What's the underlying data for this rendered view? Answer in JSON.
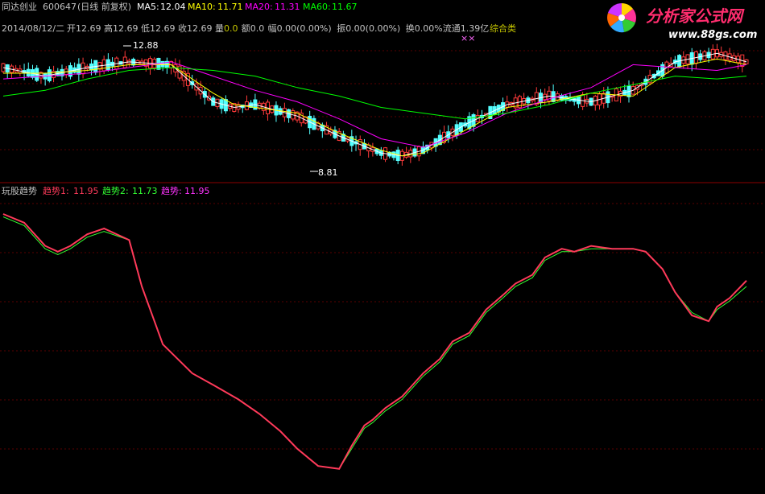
{
  "header": {
    "stock_name": "同达创业",
    "stock_code": "600647",
    "period_note": "(日线 前复权)",
    "ma_readouts": [
      {
        "label": "MA5:",
        "value": "12.04",
        "color": "#ffffff"
      },
      {
        "label": "MA10:",
        "value": "11.71",
        "color": "#ffff00"
      },
      {
        "label": "MA20:",
        "value": "11.31",
        "color": "#ff00ff"
      },
      {
        "label": "MA60:",
        "value": "11.67",
        "color": "#00ff00"
      }
    ]
  },
  "quote_line": {
    "date": "2014/08/12/二",
    "fields": [
      {
        "label": "开",
        "value": "12.69"
      },
      {
        "label": "高",
        "value": "12.69"
      },
      {
        "label": "低",
        "value": "12.69"
      },
      {
        "label": "收",
        "value": "12.69"
      },
      {
        "label": "量",
        "value": "0.0"
      },
      {
        "label": "额",
        "value": "0.0"
      },
      {
        "label": "幅",
        "value": "0.00(0.00%)"
      },
      {
        "label": "振",
        "value": "0.00(0.00%)"
      },
      {
        "label": "换",
        "value": "0.00%"
      },
      {
        "label": "流通",
        "value": "1.39亿"
      }
    ],
    "category": "综合类"
  },
  "watermark": {
    "text": "分析家公式网",
    "url": "www.88gs.com"
  },
  "indicator_header": {
    "name": "玩股趋势",
    "lines": [
      {
        "label": "趋势1:",
        "value": "11.95",
        "color": "#ff3a5a"
      },
      {
        "label": "趋势2:",
        "value": "11.73",
        "color": "#33ff33"
      },
      {
        "label": "趋势:",
        "value": "11.95",
        "color": "#ff33ff"
      }
    ]
  },
  "chart_data": [
    {
      "type": "candlestick",
      "annotations": [
        {
          "text": "12.88",
          "kind": "high"
        },
        {
          "text": "8.81",
          "kind": "low"
        },
        {
          "text": "××",
          "kind": "markers"
        }
      ],
      "ylim": [
        8.5,
        13.3
      ],
      "colors": {
        "up": "#ff3a3a",
        "down": "#54ffff",
        "ma5": "#ffffff",
        "ma10": "#ffff00",
        "ma20": "#ff00ff",
        "ma60": "#00ff00"
      },
      "series": [
        {
          "name": "MA5",
          "x": [
            0,
            10,
            20,
            30,
            40,
            50,
            55,
            60,
            70,
            80,
            90,
            95,
            100,
            110,
            120,
            130,
            140,
            150,
            160,
            170,
            177
          ],
          "values": [
            12.2,
            11.9,
            12.2,
            12.4,
            12.3,
            11.0,
            10.8,
            10.9,
            10.5,
            9.8,
            9.2,
            9.1,
            9.3,
            10.2,
            10.9,
            11.2,
            11.0,
            11.4,
            12.4,
            12.7,
            12.4
          ]
        },
        {
          "name": "MA10",
          "x": [
            0,
            10,
            20,
            30,
            40,
            50,
            55,
            60,
            70,
            80,
            90,
            95,
            100,
            110,
            120,
            130,
            140,
            150,
            160,
            170,
            177
          ],
          "values": [
            12.0,
            12.0,
            12.1,
            12.3,
            12.3,
            11.3,
            10.9,
            10.8,
            10.6,
            9.9,
            9.3,
            9.1,
            9.2,
            10.0,
            10.8,
            11.0,
            11.3,
            11.2,
            12.2,
            12.5,
            12.3
          ]
        },
        {
          "name": "MA20",
          "x": [
            0,
            10,
            20,
            30,
            40,
            50,
            60,
            70,
            80,
            90,
            100,
            110,
            120,
            130,
            140,
            150,
            160,
            170,
            177
          ],
          "values": [
            11.8,
            11.9,
            12.0,
            12.2,
            12.4,
            11.9,
            11.4,
            11.0,
            10.4,
            9.7,
            9.4,
            9.9,
            10.6,
            11.1,
            11.5,
            12.3,
            12.2,
            12.1,
            12.3
          ]
        },
        {
          "name": "MA60",
          "x": [
            0,
            10,
            20,
            30,
            40,
            50,
            60,
            70,
            80,
            90,
            100,
            110,
            120,
            130,
            140,
            150,
            160,
            170,
            177
          ],
          "values": [
            11.2,
            11.4,
            11.8,
            12.1,
            12.2,
            12.1,
            11.9,
            11.5,
            11.2,
            10.8,
            10.6,
            10.4,
            10.6,
            10.9,
            11.3,
            11.6,
            11.9,
            11.8,
            11.9
          ]
        }
      ]
    },
    {
      "type": "line",
      "title": "玩股趋势",
      "series": [
        {
          "name": "趋势1",
          "color": "#ff3a5a",
          "x": [
            0,
            5,
            10,
            13,
            16,
            20,
            24,
            30,
            33,
            38,
            45,
            50,
            56,
            61,
            66,
            70,
            75,
            80,
            83,
            86,
            88,
            91,
            95,
            100,
            104,
            107,
            111,
            115,
            119,
            122,
            126,
            129,
            133,
            136,
            140,
            145,
            150,
            153,
            157,
            160,
            164,
            168,
            170,
            173,
            177
          ],
          "values": [
            95,
            92,
            84,
            82,
            84,
            88,
            90,
            86,
            70,
            50,
            40,
            36,
            31,
            26,
            20,
            14,
            8,
            7,
            15,
            22,
            24,
            28,
            32,
            40,
            45,
            51,
            54,
            62,
            67,
            71,
            74,
            80,
            83,
            82,
            84,
            83,
            83,
            82,
            76,
            68,
            60,
            58,
            63,
            66,
            72
          ]
        },
        {
          "name": "趋势2",
          "color": "#33ff33",
          "x": [
            0,
            5,
            10,
            13,
            16,
            20,
            24,
            30,
            33,
            38,
            45,
            50,
            56,
            61,
            66,
            70,
            75,
            80,
            83,
            86,
            88,
            91,
            95,
            100,
            104,
            107,
            111,
            115,
            119,
            122,
            126,
            129,
            133,
            136,
            140,
            145,
            150,
            153,
            157,
            160,
            164,
            168,
            170,
            173,
            177
          ],
          "values": [
            94,
            91,
            83,
            81,
            83,
            87,
            89,
            86,
            70,
            50,
            40,
            36,
            31,
            26,
            20,
            14,
            8,
            7,
            14,
            21,
            23,
            27,
            31,
            39,
            44,
            50,
            53,
            61,
            66,
            70,
            73,
            79,
            82,
            82,
            83,
            83,
            83,
            82,
            76,
            68,
            61,
            58,
            62,
            65,
            70
          ]
        },
        {
          "name": "趋势",
          "color": "#ff33ff",
          "x": [
            0,
            5,
            10,
            13,
            16,
            20,
            24,
            30,
            33,
            38,
            45,
            50,
            56,
            61,
            66,
            70,
            75,
            80,
            83,
            86,
            88,
            91,
            95,
            100,
            104,
            107,
            111,
            115,
            119,
            122,
            126,
            129,
            133,
            136,
            140,
            145,
            150,
            153,
            157,
            160,
            164,
            168,
            170,
            173,
            177
          ],
          "values": [
            95,
            92,
            84,
            82,
            84,
            88,
            90,
            86,
            70,
            50,
            40,
            36,
            31,
            26,
            20,
            14,
            8,
            7,
            15,
            22,
            24,
            28,
            32,
            40,
            45,
            51,
            54,
            62,
            67,
            71,
            74,
            80,
            83,
            82,
            84,
            83,
            83,
            82,
            76,
            68,
            60,
            58,
            63,
            66,
            72
          ]
        }
      ]
    }
  ]
}
